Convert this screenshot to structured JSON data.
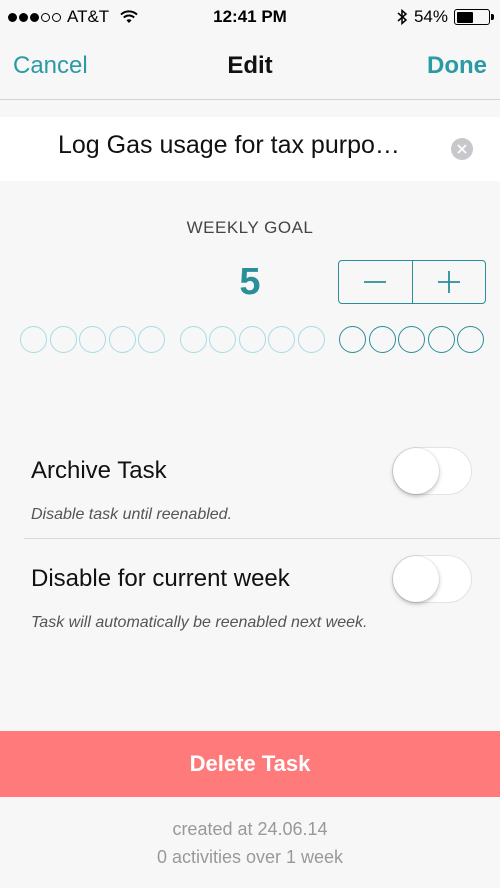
{
  "status_bar": {
    "carrier": "AT&T",
    "time": "12:41 PM",
    "battery_percent": "54%",
    "battery_level": 0.54,
    "signal_bars": 3,
    "signal_total": 5
  },
  "nav": {
    "cancel_label": "Cancel",
    "title": "Edit",
    "done_label": "Done"
  },
  "task": {
    "name": "Log Gas usage for tax purpo…"
  },
  "goal": {
    "label": "WEEKLY GOAL",
    "value": "5",
    "minus_symbol": "−",
    "plus_symbol": "+",
    "total_dots": 15,
    "active_dots": 5
  },
  "settings": {
    "archive": {
      "title": "Archive Task",
      "subtitle": "Disable task until reenabled.",
      "enabled": false
    },
    "disable_week": {
      "title": "Disable for current week",
      "subtitle": "Task will automatically be reenabled next week.",
      "enabled": false
    }
  },
  "delete_label": "Delete Task",
  "footer": {
    "created": "created at 24.06.14",
    "activities": "0 activities over 1 week"
  },
  "colors": {
    "accent": "#2a9aa4",
    "goal_value": "#2a8f99",
    "dot_inactive": "#a6dce3",
    "delete_bg": "#ff7b7b"
  }
}
